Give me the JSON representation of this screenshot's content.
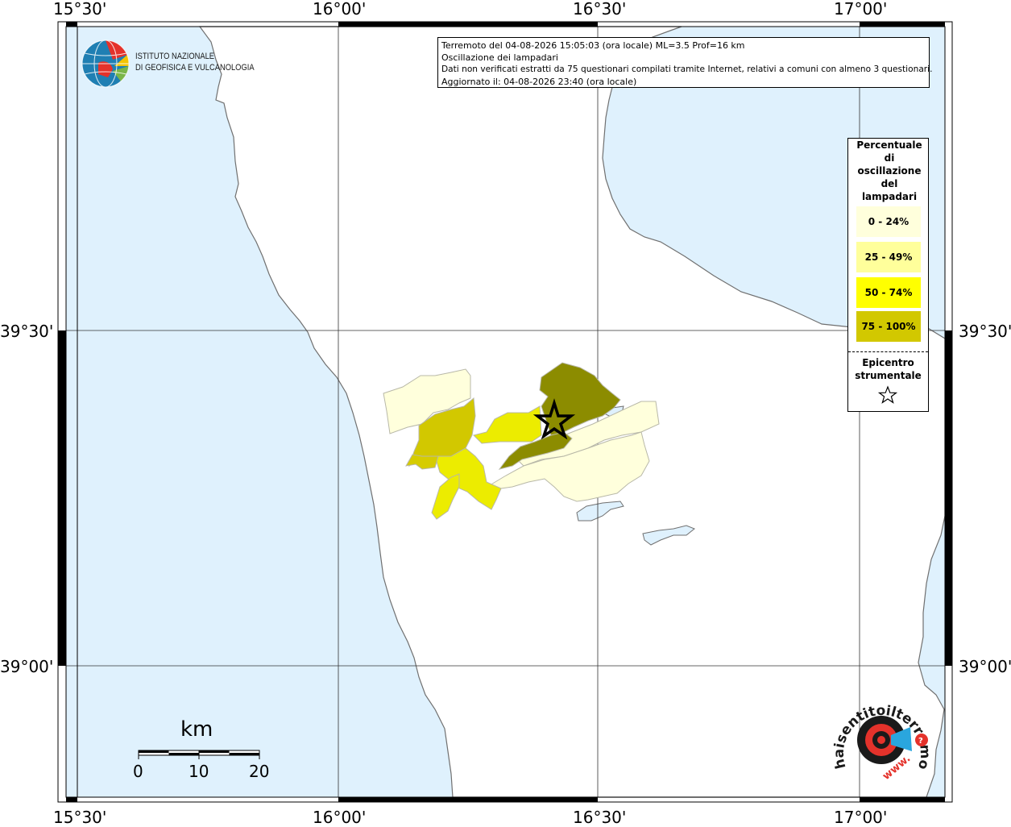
{
  "header": {
    "line1": "Terremoto del 04-08-2026 15:05:03 (ora locale) ML=3.5 Prof=16 km",
    "line2": "Oscillazione dei lampadari",
    "line3": "Dati non verificati estratti da 75 questionari compilati tramite Internet, relativi a comuni con almeno 3 questionari.",
    "line4": "Aggiornato il: 04-08-2026 23:40 (ora locale)"
  },
  "institute": {
    "line1": "ISTITUTO NAZIONALE",
    "line2": "DI GEOFISICA E VULCANOLOGIA"
  },
  "coords": {
    "top": [
      "15°30'",
      "16°00'",
      "16°30'",
      "17°00'"
    ],
    "bottom": [
      "15°30'",
      "16°00'",
      "16°30'",
      "17°00'"
    ],
    "left": [
      "39°30'",
      "39°00'"
    ],
    "right": [
      "39°30'",
      "39°00'"
    ]
  },
  "legend": {
    "title": "Percentuale di oscillazione del lampadari",
    "classes": [
      {
        "label": "0 - 24%",
        "color": "#ffffdc"
      },
      {
        "label": "25 - 49%",
        "color": "#ffff9b"
      },
      {
        "label": "50 - 74%",
        "color": "#ffff00"
      },
      {
        "label": "75 - 100%",
        "color": "#d2c800"
      }
    ],
    "epicenter_title": "Epicentro strumentale",
    "epicenter_icon": "star-icon"
  },
  "scale": {
    "unit": "km",
    "labels": [
      "0",
      "10",
      "20"
    ]
  },
  "colors": {
    "sea": "#dff1fd",
    "land": "#ffffff",
    "class1": "#ffffdc",
    "class2": "#ffff9b",
    "class3": "#ffff00",
    "class4": "#d2c800",
    "dark_class": "#8c8c00"
  },
  "logo_hst": {
    "text": "haisentitoilterremoto.it",
    "prefix": "www."
  }
}
